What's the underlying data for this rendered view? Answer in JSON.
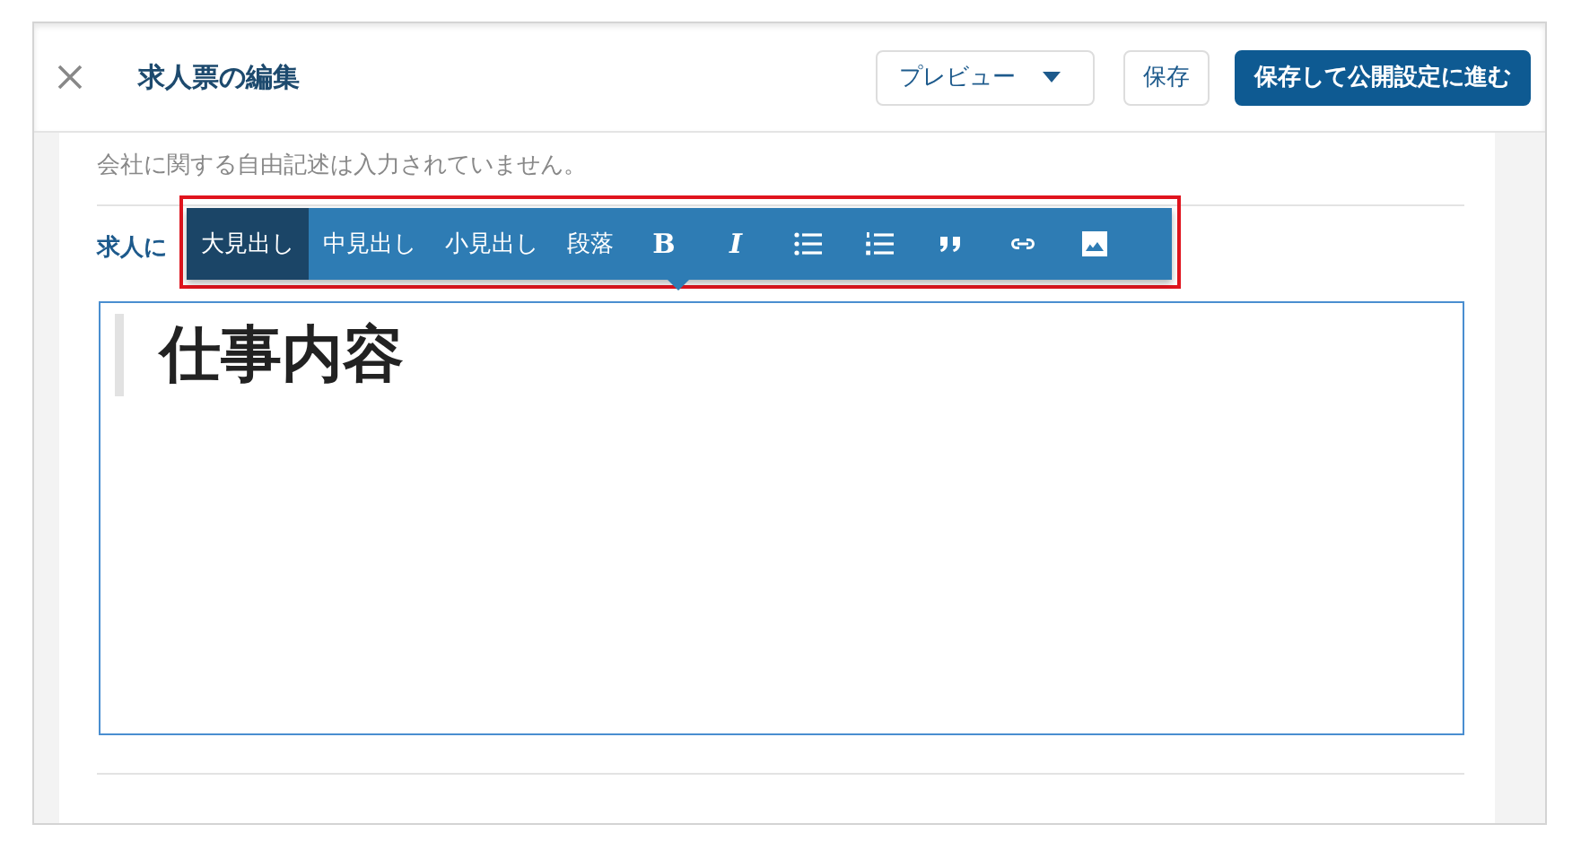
{
  "header": {
    "title": "求人票の編集",
    "preview_button": "プレビュー",
    "save_button": "保存",
    "publish_button": "保存して公開設定に進む"
  },
  "company_note": "会社に関する自由記述は入力されていません。",
  "section_label": "求人に",
  "toolbar": {
    "blocks": [
      {
        "label": "大見出し",
        "selected": true
      },
      {
        "label": "中見出し",
        "selected": false
      },
      {
        "label": "小見出し",
        "selected": false
      },
      {
        "label": "段落",
        "selected": false
      }
    ],
    "glyphs": [
      "B",
      "I"
    ]
  },
  "editor": {
    "heading": "仕事内容"
  }
}
